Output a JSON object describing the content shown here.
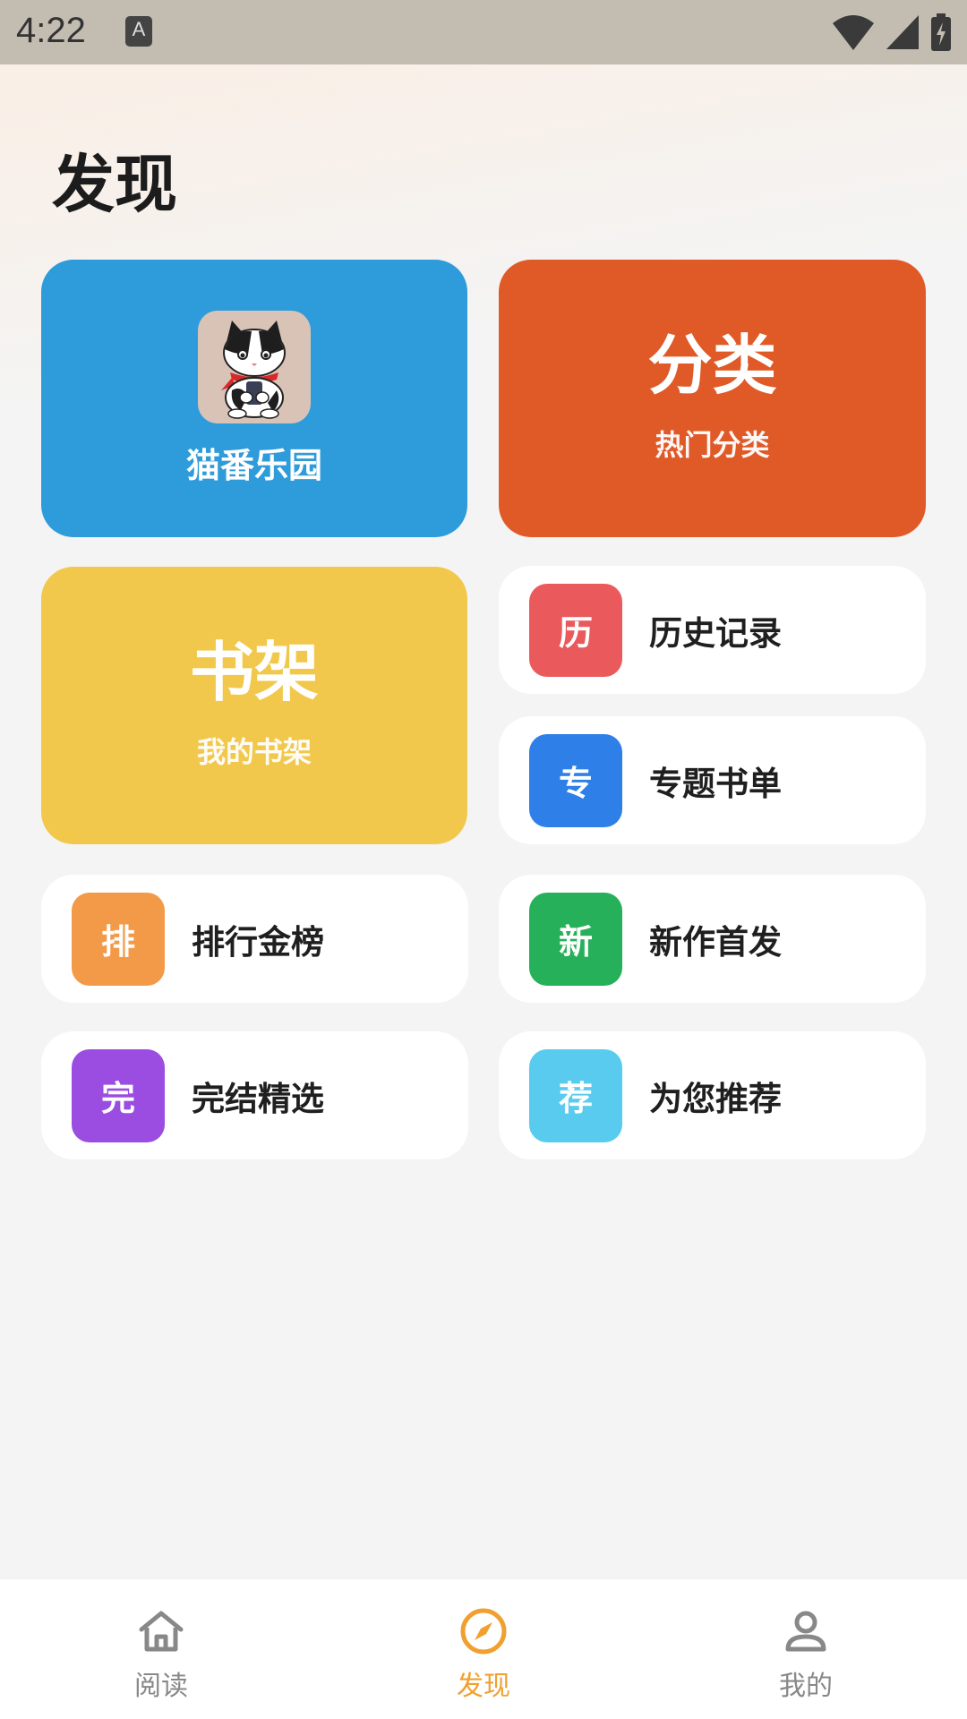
{
  "status_bar": {
    "time": "4:22",
    "notification_icon": "A"
  },
  "header": {
    "title": "发现"
  },
  "cards": {
    "cat": {
      "label": "猫番乐园",
      "color": "#2e9bdb"
    },
    "fenlei": {
      "title": "分类",
      "subtitle": "热门分类",
      "color": "#e05a28"
    },
    "shujia": {
      "title": "书架",
      "subtitle": "我的书架",
      "color": "#f2c84c"
    }
  },
  "list_items": [
    {
      "badge": "历",
      "label": "历史记录",
      "color": "#ea5a5d"
    },
    {
      "badge": "专",
      "label": "专题书单",
      "color": "#2f7fe8"
    },
    {
      "badge": "排",
      "label": "排行金榜",
      "color": "#f39a48"
    },
    {
      "badge": "新",
      "label": "新作首发",
      "color": "#27b05a"
    },
    {
      "badge": "完",
      "label": "完结精选",
      "color": "#9a4de0"
    },
    {
      "badge": "荐",
      "label": "为您推荐",
      "color": "#58cbef"
    }
  ],
  "nav": {
    "items": [
      {
        "label": "阅读",
        "icon": "home-icon",
        "active": false
      },
      {
        "label": "发现",
        "icon": "compass-icon",
        "active": true
      },
      {
        "label": "我的",
        "icon": "user-icon",
        "active": false
      }
    ],
    "active_color": "#f0a030",
    "inactive_color": "#888888"
  }
}
